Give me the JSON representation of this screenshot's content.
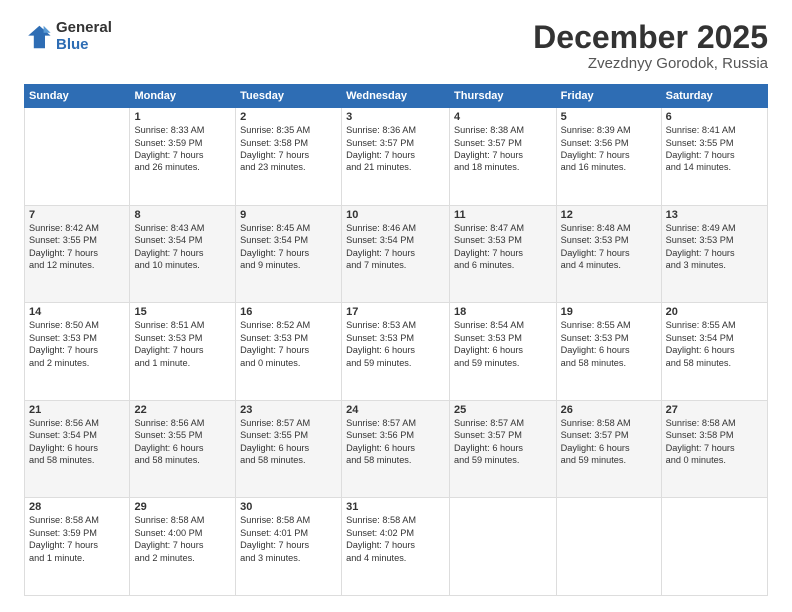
{
  "logo": {
    "general": "General",
    "blue": "Blue"
  },
  "header": {
    "month": "December 2025",
    "location": "Zvezdnyy Gorodok, Russia"
  },
  "days_of_week": [
    "Sunday",
    "Monday",
    "Tuesday",
    "Wednesday",
    "Thursday",
    "Friday",
    "Saturday"
  ],
  "weeks": [
    [
      {
        "day": "",
        "info": ""
      },
      {
        "day": "1",
        "info": "Sunrise: 8:33 AM\nSunset: 3:59 PM\nDaylight: 7 hours\nand 26 minutes."
      },
      {
        "day": "2",
        "info": "Sunrise: 8:35 AM\nSunset: 3:58 PM\nDaylight: 7 hours\nand 23 minutes."
      },
      {
        "day": "3",
        "info": "Sunrise: 8:36 AM\nSunset: 3:57 PM\nDaylight: 7 hours\nand 21 minutes."
      },
      {
        "day": "4",
        "info": "Sunrise: 8:38 AM\nSunset: 3:57 PM\nDaylight: 7 hours\nand 18 minutes."
      },
      {
        "day": "5",
        "info": "Sunrise: 8:39 AM\nSunset: 3:56 PM\nDaylight: 7 hours\nand 16 minutes."
      },
      {
        "day": "6",
        "info": "Sunrise: 8:41 AM\nSunset: 3:55 PM\nDaylight: 7 hours\nand 14 minutes."
      }
    ],
    [
      {
        "day": "7",
        "info": "Sunrise: 8:42 AM\nSunset: 3:55 PM\nDaylight: 7 hours\nand 12 minutes."
      },
      {
        "day": "8",
        "info": "Sunrise: 8:43 AM\nSunset: 3:54 PM\nDaylight: 7 hours\nand 10 minutes."
      },
      {
        "day": "9",
        "info": "Sunrise: 8:45 AM\nSunset: 3:54 PM\nDaylight: 7 hours\nand 9 minutes."
      },
      {
        "day": "10",
        "info": "Sunrise: 8:46 AM\nSunset: 3:54 PM\nDaylight: 7 hours\nand 7 minutes."
      },
      {
        "day": "11",
        "info": "Sunrise: 8:47 AM\nSunset: 3:53 PM\nDaylight: 7 hours\nand 6 minutes."
      },
      {
        "day": "12",
        "info": "Sunrise: 8:48 AM\nSunset: 3:53 PM\nDaylight: 7 hours\nand 4 minutes."
      },
      {
        "day": "13",
        "info": "Sunrise: 8:49 AM\nSunset: 3:53 PM\nDaylight: 7 hours\nand 3 minutes."
      }
    ],
    [
      {
        "day": "14",
        "info": "Sunrise: 8:50 AM\nSunset: 3:53 PM\nDaylight: 7 hours\nand 2 minutes."
      },
      {
        "day": "15",
        "info": "Sunrise: 8:51 AM\nSunset: 3:53 PM\nDaylight: 7 hours\nand 1 minute."
      },
      {
        "day": "16",
        "info": "Sunrise: 8:52 AM\nSunset: 3:53 PM\nDaylight: 7 hours\nand 0 minutes."
      },
      {
        "day": "17",
        "info": "Sunrise: 8:53 AM\nSunset: 3:53 PM\nDaylight: 6 hours\nand 59 minutes."
      },
      {
        "day": "18",
        "info": "Sunrise: 8:54 AM\nSunset: 3:53 PM\nDaylight: 6 hours\nand 59 minutes."
      },
      {
        "day": "19",
        "info": "Sunrise: 8:55 AM\nSunset: 3:53 PM\nDaylight: 6 hours\nand 58 minutes."
      },
      {
        "day": "20",
        "info": "Sunrise: 8:55 AM\nSunset: 3:54 PM\nDaylight: 6 hours\nand 58 minutes."
      }
    ],
    [
      {
        "day": "21",
        "info": "Sunrise: 8:56 AM\nSunset: 3:54 PM\nDaylight: 6 hours\nand 58 minutes."
      },
      {
        "day": "22",
        "info": "Sunrise: 8:56 AM\nSunset: 3:55 PM\nDaylight: 6 hours\nand 58 minutes."
      },
      {
        "day": "23",
        "info": "Sunrise: 8:57 AM\nSunset: 3:55 PM\nDaylight: 6 hours\nand 58 minutes."
      },
      {
        "day": "24",
        "info": "Sunrise: 8:57 AM\nSunset: 3:56 PM\nDaylight: 6 hours\nand 58 minutes."
      },
      {
        "day": "25",
        "info": "Sunrise: 8:57 AM\nSunset: 3:57 PM\nDaylight: 6 hours\nand 59 minutes."
      },
      {
        "day": "26",
        "info": "Sunrise: 8:58 AM\nSunset: 3:57 PM\nDaylight: 6 hours\nand 59 minutes."
      },
      {
        "day": "27",
        "info": "Sunrise: 8:58 AM\nSunset: 3:58 PM\nDaylight: 7 hours\nand 0 minutes."
      }
    ],
    [
      {
        "day": "28",
        "info": "Sunrise: 8:58 AM\nSunset: 3:59 PM\nDaylight: 7 hours\nand 1 minute."
      },
      {
        "day": "29",
        "info": "Sunrise: 8:58 AM\nSunset: 4:00 PM\nDaylight: 7 hours\nand 2 minutes."
      },
      {
        "day": "30",
        "info": "Sunrise: 8:58 AM\nSunset: 4:01 PM\nDaylight: 7 hours\nand 3 minutes."
      },
      {
        "day": "31",
        "info": "Sunrise: 8:58 AM\nSunset: 4:02 PM\nDaylight: 7 hours\nand 4 minutes."
      },
      {
        "day": "",
        "info": ""
      },
      {
        "day": "",
        "info": ""
      },
      {
        "day": "",
        "info": ""
      }
    ]
  ]
}
